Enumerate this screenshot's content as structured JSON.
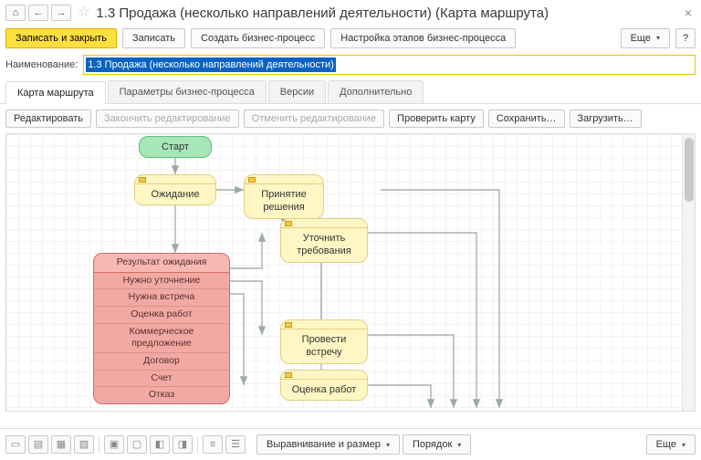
{
  "titlebar": {
    "title": "1.3 Продажа (несколько направлений деятельности) (Карта маршрута)"
  },
  "cmdbar": {
    "save_close": "Записать и закрыть",
    "save": "Записать",
    "create_bp": "Создать бизнес-процесс",
    "stages": "Настройка этапов бизнес-процесса",
    "more": "Еще",
    "help": "?"
  },
  "name": {
    "label": "Наименование:",
    "value": "1.3 Продажа (несколько направлений деятельности)"
  },
  "tabs": {
    "route": "Карта маршрута",
    "params": "Параметры бизнес-процесса",
    "versions": "Версии",
    "extra": "Дополнительно"
  },
  "toolbar": {
    "edit": "Редактировать",
    "finish_edit": "Закончить редактирование",
    "cancel_edit": "Отменить редактирование",
    "check": "Проверить карту",
    "save": "Сохранить…",
    "load": "Загрузить…"
  },
  "nodes": {
    "start": "Старт",
    "wait": "Ожидание",
    "decision": "Принятие решения",
    "clarify": "Уточнить требования",
    "meeting": "Провести встречу",
    "estimate": "Оценка работ",
    "cond_title": "Результат ожидания",
    "cond_rows": [
      "Нужно уточнение",
      "Нужна встреча",
      "Оценка работ",
      "Коммерческое предложение",
      "Договор",
      "Счет",
      "Отказ"
    ]
  },
  "bottombar": {
    "align": "Выравнивание и размер",
    "order": "Порядок",
    "more": "Еще"
  }
}
